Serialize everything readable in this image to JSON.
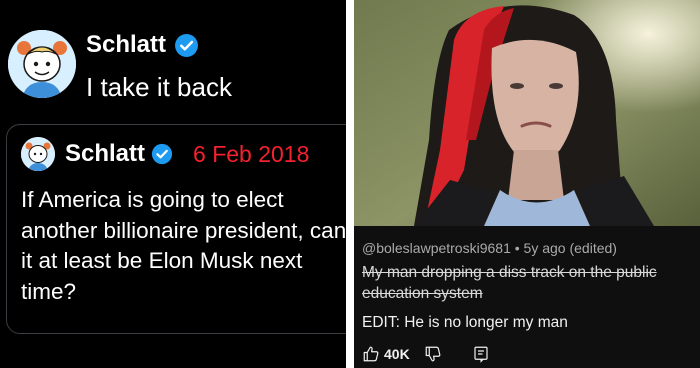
{
  "colors": {
    "verified_blue": "#1d9bf0",
    "date_red": "#f4212e",
    "tweet_bg": "#000000",
    "comment_bg": "#0f0f0f"
  },
  "tweet": {
    "author": "Schlatt",
    "text": "I take it back",
    "avatar_icon": "cartoon-avatar",
    "quoted": {
      "author": "Schlatt",
      "date": "6 Feb 2018",
      "text": "If America is going to elect another billionaire president, can it at least be Elon Musk next time?"
    }
  },
  "youtube_comment": {
    "handle": "@boleslawpetroski9681",
    "age": "5y ago (edited)",
    "struck_text": "My man dropping a diss track on the public education system",
    "edit_text": "EDIT: He is no longer my man",
    "likes": "40K",
    "icons": [
      "thumbs-up-icon",
      "thumbs-down-icon",
      "reply-icon"
    ]
  }
}
